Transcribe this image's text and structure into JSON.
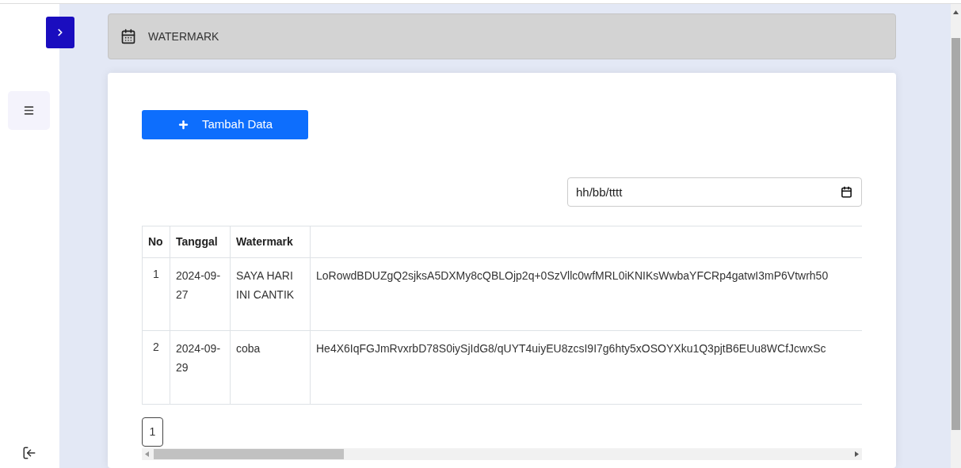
{
  "header": {
    "title": "WATERMARK"
  },
  "add_button": {
    "label": "Tambah Data"
  },
  "date_filter": {
    "placeholder": "hh/bb/tttt"
  },
  "table": {
    "columns": [
      "No",
      "Tanggal",
      "Watermark"
    ],
    "rows": [
      {
        "no": "1",
        "date": "2024-09-27",
        "watermark": "SAYA HARI INI CANTIK",
        "column_4": "LoRowdBDUZgQ2sjksA5DXMy8cQBLOjp2q+0SzVllc0wfMRL0iKNIKsWwbaYFCRp4gatwI3mP6Vtwrh50"
      },
      {
        "no": "2",
        "date": "2024-09-29",
        "watermark": "coba",
        "column_4": "He4X6IqFGJmRvxrbD78S0iySjIdG8/qUYT4uiyEU8zcsI9I7g6hty5xOSOYXku1Q3pjtB6EUu8WCfJcwxSc"
      }
    ]
  },
  "pagination": [
    {
      "label": "1",
      "selected": true
    }
  ]
}
